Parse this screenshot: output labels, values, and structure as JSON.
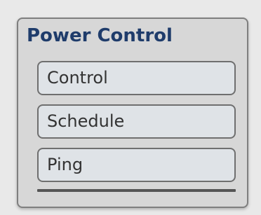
{
  "panel": {
    "title": "Power Control",
    "title_color": "#1f3c6b",
    "items": [
      {
        "label": "Control"
      },
      {
        "label": "Schedule"
      },
      {
        "label": "Ping"
      }
    ]
  }
}
